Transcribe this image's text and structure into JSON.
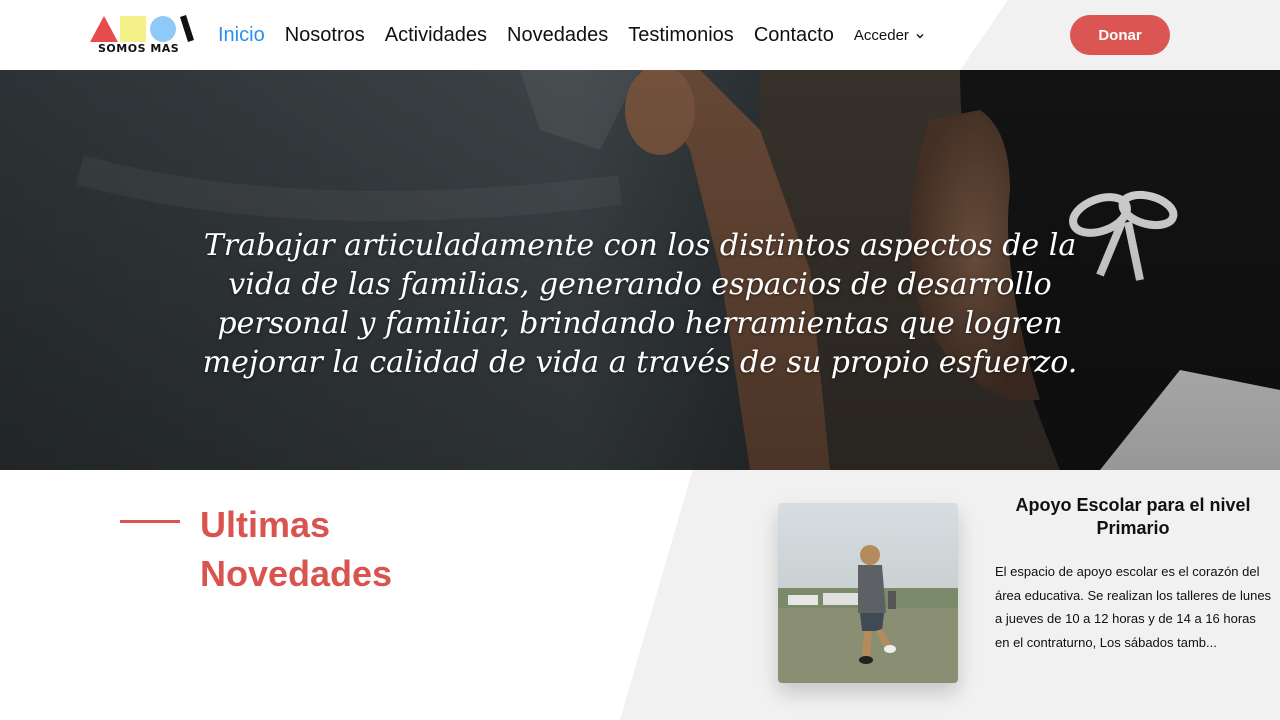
{
  "logo": {
    "text": "SOMOS MAS",
    "colors": {
      "triangle": "#e74c4c",
      "square": "#f5f18a",
      "circle": "#8ec9f7",
      "bar": "#111111"
    }
  },
  "nav": {
    "items": [
      {
        "label": "Inicio",
        "active": true
      },
      {
        "label": "Nosotros",
        "active": false
      },
      {
        "label": "Actividades",
        "active": false
      },
      {
        "label": "Novedades",
        "active": false
      },
      {
        "label": "Testimonios",
        "active": false
      },
      {
        "label": "Contacto",
        "active": false
      }
    ],
    "dropdown": {
      "label": "Acceder",
      "icon": "chevron-down-icon"
    },
    "active_color": "#2a8ff2"
  },
  "donate": {
    "label": "Donar",
    "color": "#db5552"
  },
  "hero": {
    "text": "Trabajar articuladamente con los distintos aspectos de la vida de las familias, generando espacios de desarrollo personal y familiar, brindando herramientas que logren mejorar la calidad de vida a través de su propio esfuerzo."
  },
  "news": {
    "title": "Ultimas Novedades",
    "accent": "#d9534f",
    "card": {
      "title": "Apoyo Escolar para el nivel Primario",
      "text": "El espacio de apoyo escolar es el corazón del área educativa. Se realizan los talleres de lunes a jueves de 10 a 12 horas y de 14 a 16 horas en el contraturno, Los sábados tamb..."
    }
  }
}
